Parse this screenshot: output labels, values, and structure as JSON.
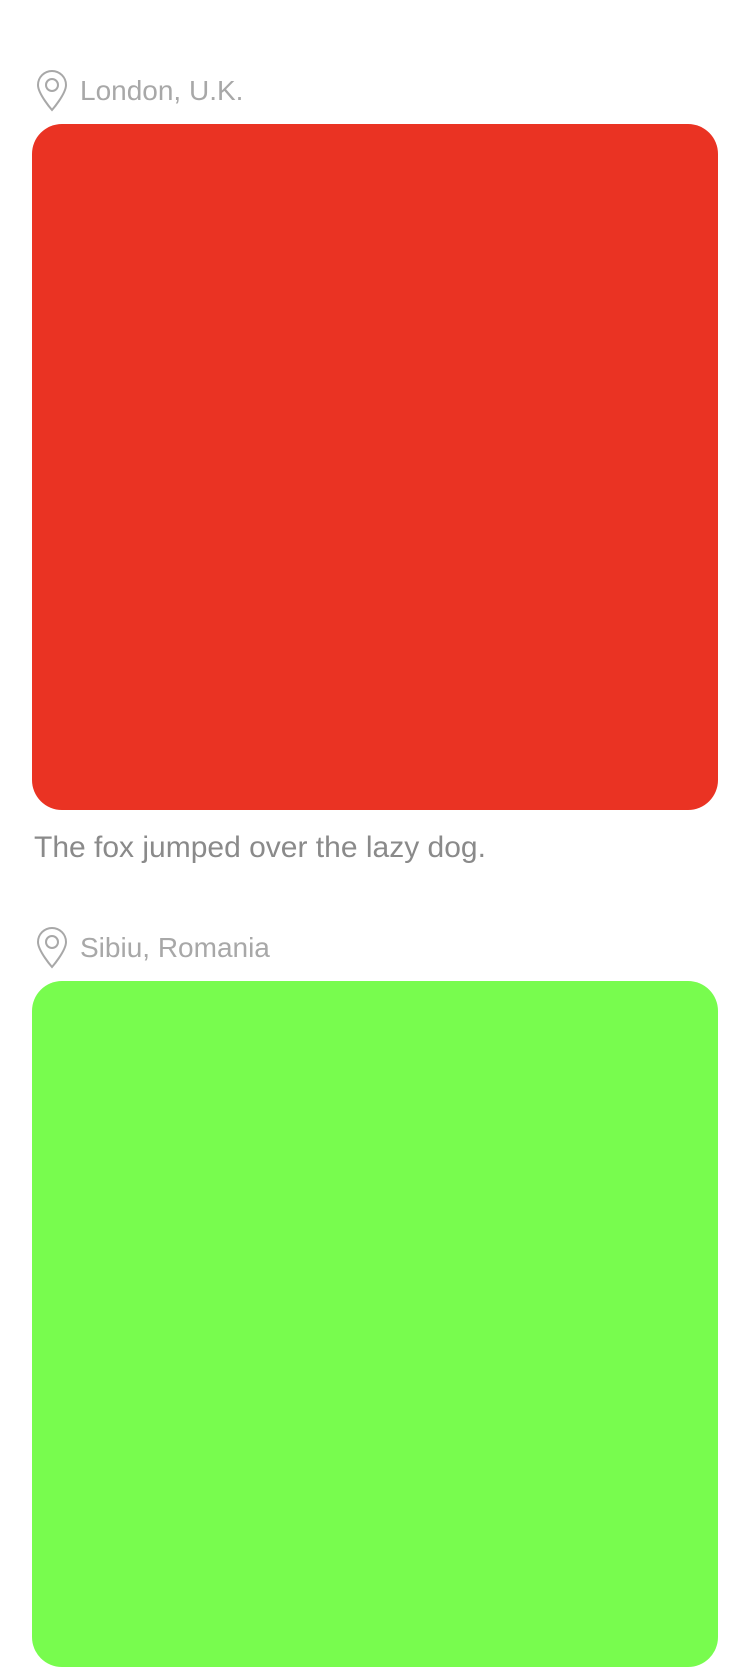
{
  "feed": {
    "posts": [
      {
        "location": "London, U.K.",
        "location_icon": "map-pin-icon",
        "image_color": "#EA3323",
        "caption": "The fox jumped over the lazy dog."
      },
      {
        "location": "Sibiu, Romania",
        "location_icon": "map-pin-icon",
        "image_color": "#78FC4E",
        "caption": ""
      }
    ]
  }
}
